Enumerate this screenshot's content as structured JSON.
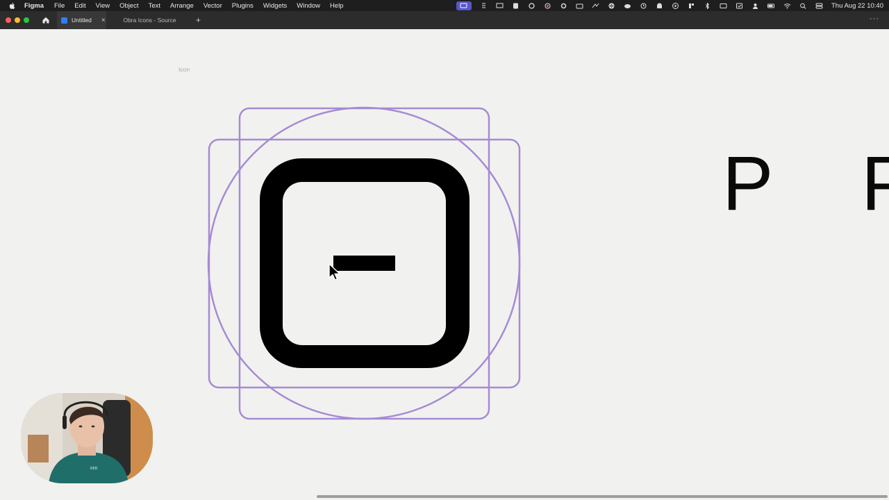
{
  "menubar": {
    "app_name": "Figma",
    "items": [
      "File",
      "Edit",
      "View",
      "Object",
      "Text",
      "Arrange",
      "Vector",
      "Plugins",
      "Widgets",
      "Window",
      "Help"
    ],
    "clock": "Thu Aug 22  10:40"
  },
  "tabs": {
    "active_label": "Untitled",
    "inactive_label": "Obra Icons - Source",
    "new_tab": "+",
    "close": "×",
    "more": "···"
  },
  "canvas": {
    "frame_label": "Icon",
    "glyphs": [
      "P",
      "P"
    ],
    "keyline_color": "#9a78d0",
    "icon_color": "#000000",
    "background": "#f1f2ef"
  },
  "overlay": {
    "webcam": "presenter webcam"
  }
}
